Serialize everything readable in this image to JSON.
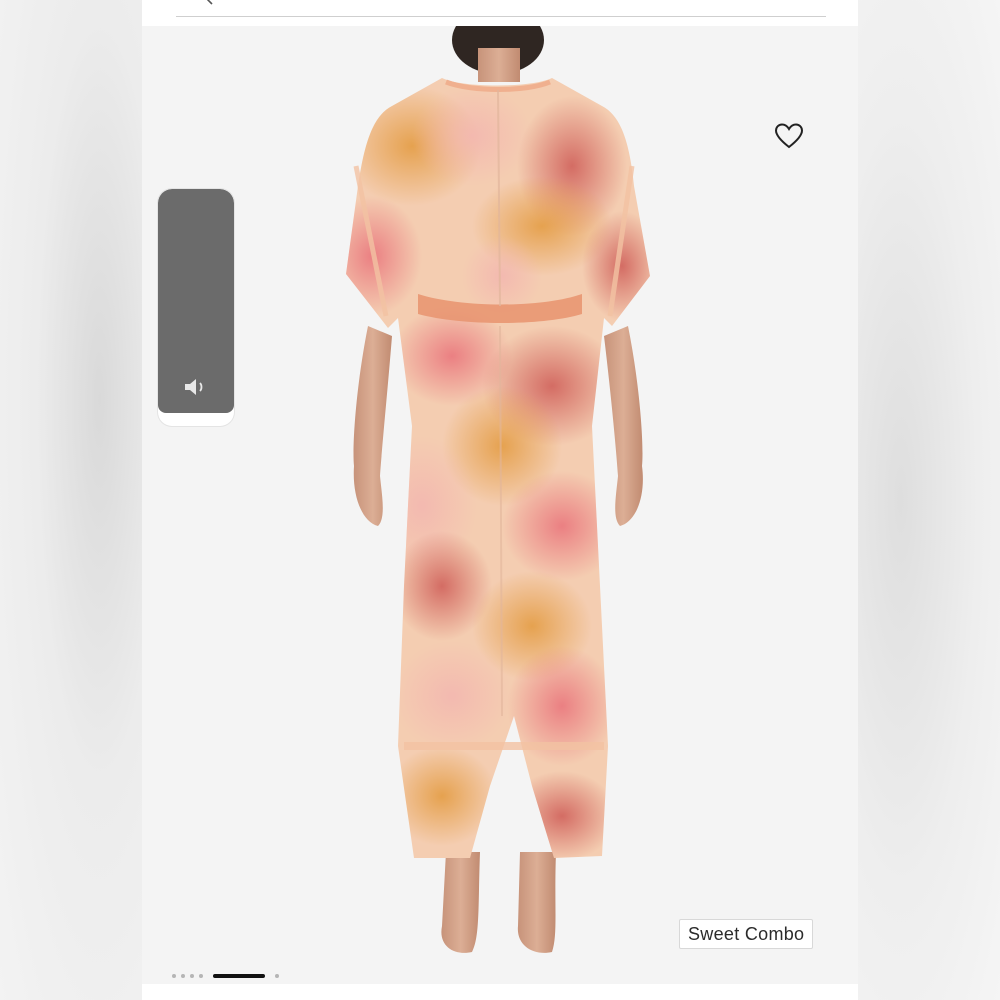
{
  "product": {
    "brand": "Sweet Combo",
    "image_count": 7,
    "active_image": 5
  },
  "icons": {
    "wishlist": "heart-outline-icon",
    "audio": "speaker-icon",
    "search": "search-icon"
  },
  "colors": {
    "page_bg": "#ffffff",
    "side_bg": "#ededed",
    "video_bg": "#6b6b6b",
    "active_dot": "#111111",
    "inactive_dot": "#b5b5b5"
  }
}
